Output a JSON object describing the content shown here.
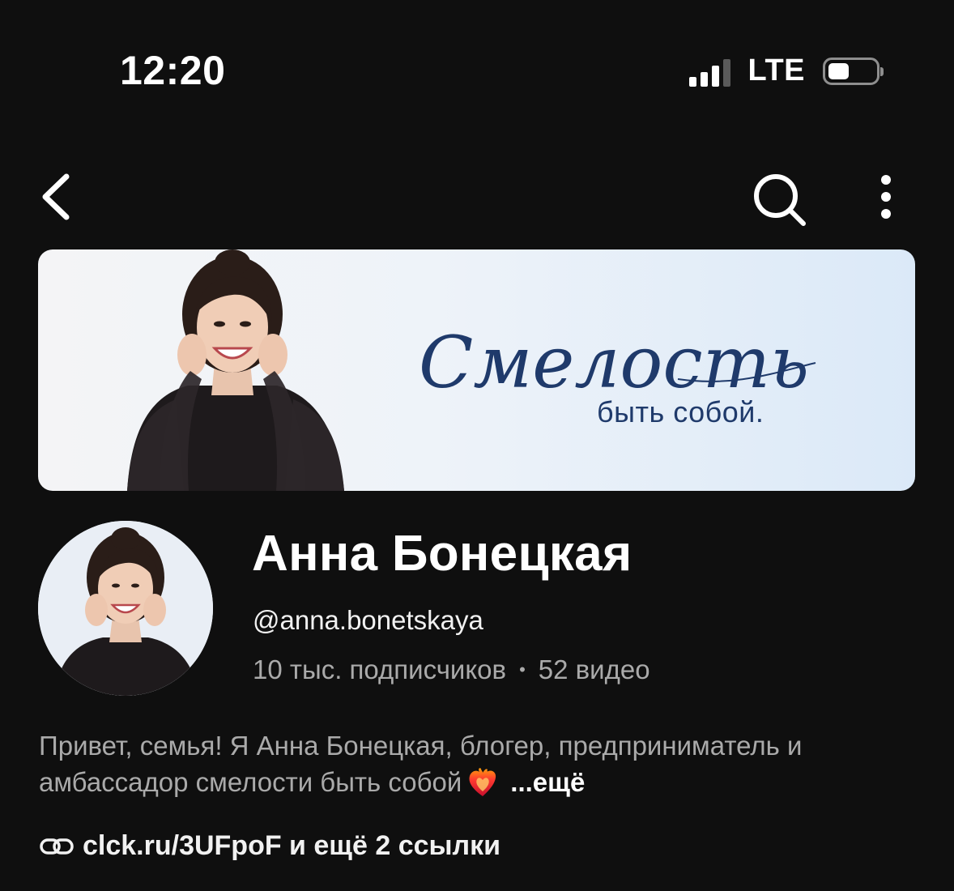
{
  "status_bar": {
    "time": "12:20",
    "network": "LTE",
    "signal_bars_active": 3,
    "signal_bars_total": 4,
    "battery_level": 0.45
  },
  "nav": {
    "back_icon": "chevron-left-icon",
    "search_icon": "search-icon",
    "more_icon": "more-vertical-icon"
  },
  "banner": {
    "script_text": "Смелость",
    "tagline": "быть собой."
  },
  "channel": {
    "name": "Анна Бонецкая",
    "handle": "@anna.bonetskaya",
    "subscribers": "10 тыс. подписчиков",
    "separator": "•",
    "videos": "52 видео"
  },
  "description": {
    "text": "Привет, семья! Я Анна Бонецкая, блогер, предприниматель и амбассадор смелости быть собой",
    "emoji": "heart-on-fire-icon",
    "more_label": "...ещё"
  },
  "links": {
    "icon": "link-icon",
    "text": "clck.ru/3UFpoF и ещё 2 ссылки"
  },
  "colors": {
    "background": "#0f0f0f",
    "primary_text": "#f1f1f1",
    "secondary_text": "#aaaaaa",
    "banner_text": "#1f3a6b"
  }
}
